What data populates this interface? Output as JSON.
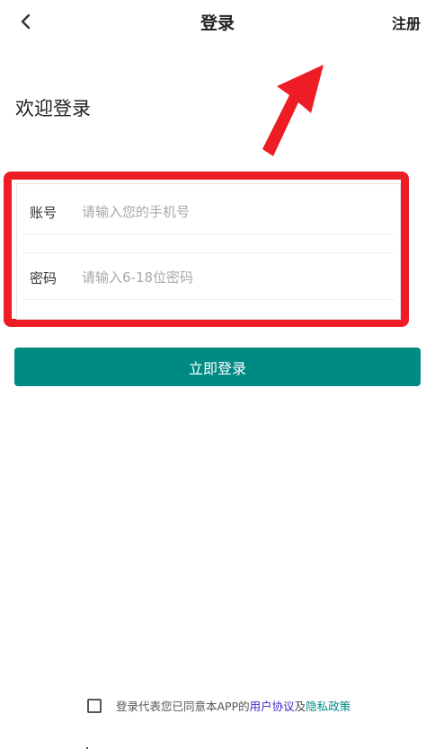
{
  "nav": {
    "title": "登录",
    "register_label": "注册",
    "back_icon": "chevron-left-icon"
  },
  "welcome": "欢迎登录",
  "form": {
    "account": {
      "label": "账号",
      "placeholder": "请输入您的手机号",
      "value": ""
    },
    "password": {
      "label": "密码",
      "placeholder": "请输入6-18位密码",
      "value": ""
    }
  },
  "login_button": "立即登录",
  "agreement": {
    "checked": false,
    "prefix": "登录代表您已同意本APP的",
    "user_agreement": "用户协议",
    "conjunction": "及",
    "privacy_policy": "隐私政策"
  },
  "colors": {
    "accent": "#008a84",
    "annotation": "#ee1c25",
    "user_agreement_link": "#3b24c8",
    "privacy_link": "#008a84"
  }
}
